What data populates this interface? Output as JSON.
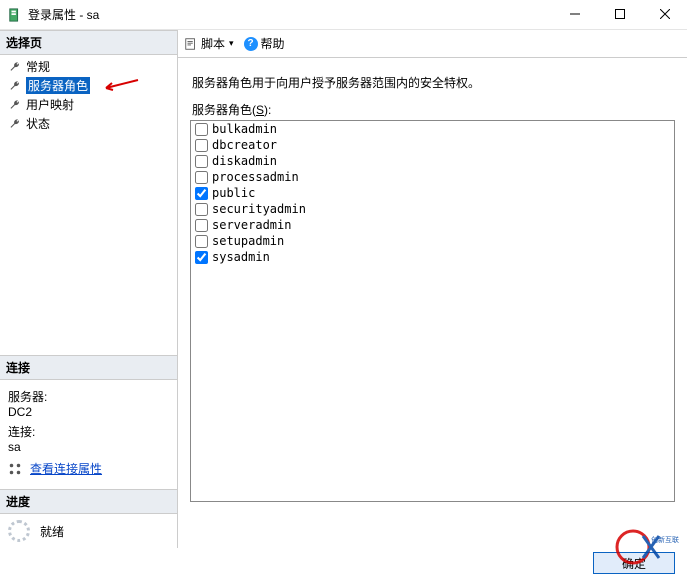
{
  "window": {
    "title": "登录属性 - sa"
  },
  "sidebar": {
    "select_page_label": "选择页",
    "items": [
      {
        "label": "常规"
      },
      {
        "label": "服务器角色"
      },
      {
        "label": "用户映射"
      },
      {
        "label": "状态"
      }
    ],
    "connection_header": "连接",
    "server_label": "服务器:",
    "server_value": "DC2",
    "connection_label": "连接:",
    "connection_value": "sa",
    "view_conn_props": "查看连接属性",
    "progress_header": "进度",
    "progress_status": "就绪"
  },
  "toolbar": {
    "script_label": "脚本",
    "help_label": "帮助"
  },
  "main": {
    "description": "服务器角色用于向用户授予服务器范围内的安全特权。",
    "roles_label_prefix": "服务器角色(",
    "roles_label_underline": "S",
    "roles_label_suffix": "):",
    "roles": [
      {
        "name": "bulkadmin",
        "checked": false
      },
      {
        "name": "dbcreator",
        "checked": false
      },
      {
        "name": "diskadmin",
        "checked": false
      },
      {
        "name": "processadmin",
        "checked": false
      },
      {
        "name": "public",
        "checked": true
      },
      {
        "name": "securityadmin",
        "checked": false
      },
      {
        "name": "serveradmin",
        "checked": false
      },
      {
        "name": "setupadmin",
        "checked": false
      },
      {
        "name": "sysadmin",
        "checked": true
      }
    ]
  },
  "footer": {
    "ok_label": "确定"
  },
  "watermark": {
    "brand": "创新互联"
  }
}
